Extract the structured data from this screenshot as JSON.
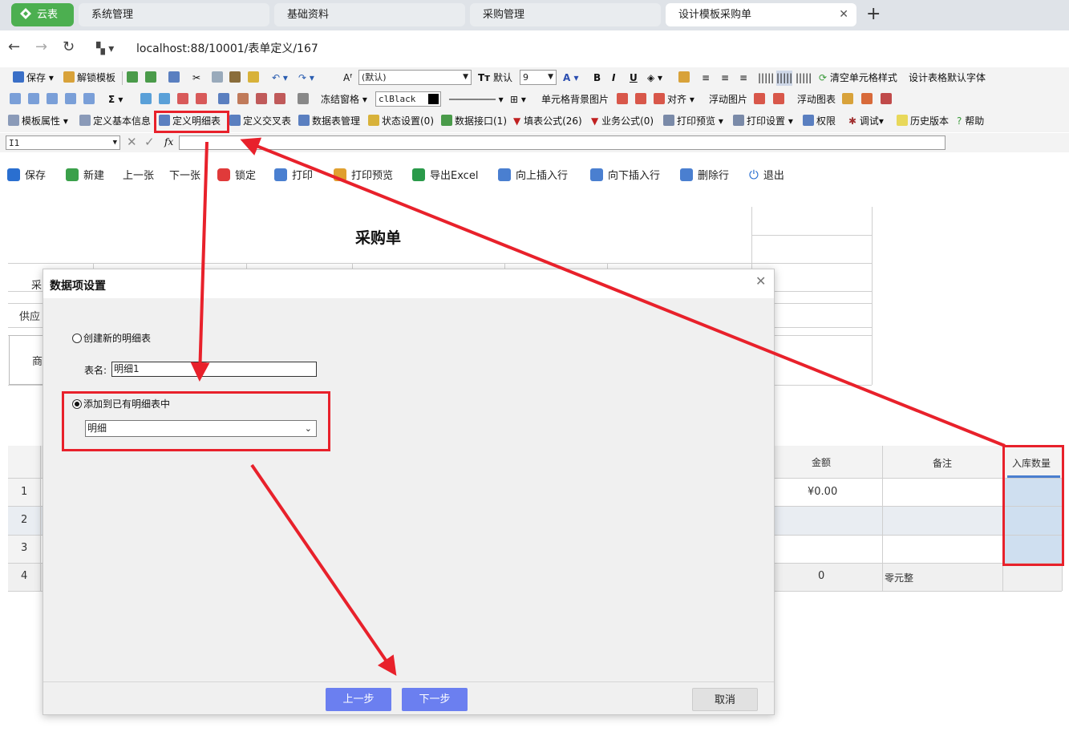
{
  "browser": {
    "tabs": [
      {
        "label": "云表",
        "kind": "brand"
      },
      {
        "label": "系统管理"
      },
      {
        "label": "基础资料"
      },
      {
        "label": "采购管理"
      },
      {
        "label": "设计模板采购单",
        "active": true
      }
    ],
    "url": "localhost:88/10001/表单定义/167"
  },
  "toolbar1": {
    "save": "保存",
    "unlock": "解锁模板",
    "font_size_label": "默认",
    "font_name": "(默认)",
    "font_size": "9",
    "clear_style": "清空单元格样式",
    "default_font": "设计表格默认字体"
  },
  "toolbar2": {
    "freeze": "冻结窗格",
    "color": "clBlack",
    "cell_bg": "单元格背景图片",
    "align": "对齐",
    "float_img": "浮动图片",
    "float_chart": "浮动图表"
  },
  "toolbar3": {
    "template_props": "模板属性",
    "basic_info": "定义基本信息",
    "detail_table": "定义明细表",
    "cross_table": "定义交叉表",
    "datatable_mgmt": "数据表管理",
    "status": "状态设置(0)",
    "data_interface": "数据接口(1)",
    "fill_formula": "填表公式(26)",
    "biz_formula": "业务公式(0)",
    "print_preview": "打印预览",
    "print_settings": "打印设置",
    "permission": "权限",
    "debug": "调试",
    "history": "历史版本",
    "help": "帮助"
  },
  "formula_bar": {
    "cell_ref": "I1",
    "fx": "fx"
  },
  "actions": [
    "保存",
    "新建",
    "上一张",
    "下一张",
    "锁定",
    "打印",
    "打印预览",
    "导出Excel",
    "向上插入行",
    "向下插入行",
    "删除行",
    "退出"
  ],
  "sheet": {
    "title": "采购单",
    "label_purchase": "采",
    "label_supplier": "供应",
    "label_goods": "商",
    "headers": {
      "amount": "金额",
      "remark": "备注",
      "inbound_qty": "入库数量"
    },
    "rows": [
      "1",
      "2",
      "3",
      "4"
    ],
    "amount_row1": "¥0.00",
    "total_amount": "0",
    "total_text": "零元整"
  },
  "dialog": {
    "title": "数据项设置",
    "opt_new": "创建新的明细表",
    "table_name_label": "表名:",
    "table_name_value": "明细1",
    "opt_existing": "添加到已有明细表中",
    "existing_value": "明细",
    "btn_prev": "上一步",
    "btn_next": "下一步",
    "btn_cancel": "取消"
  },
  "colors": {
    "accent": "#6b7ff0",
    "annotation": "#e8212b",
    "brand": "#4caf50"
  }
}
